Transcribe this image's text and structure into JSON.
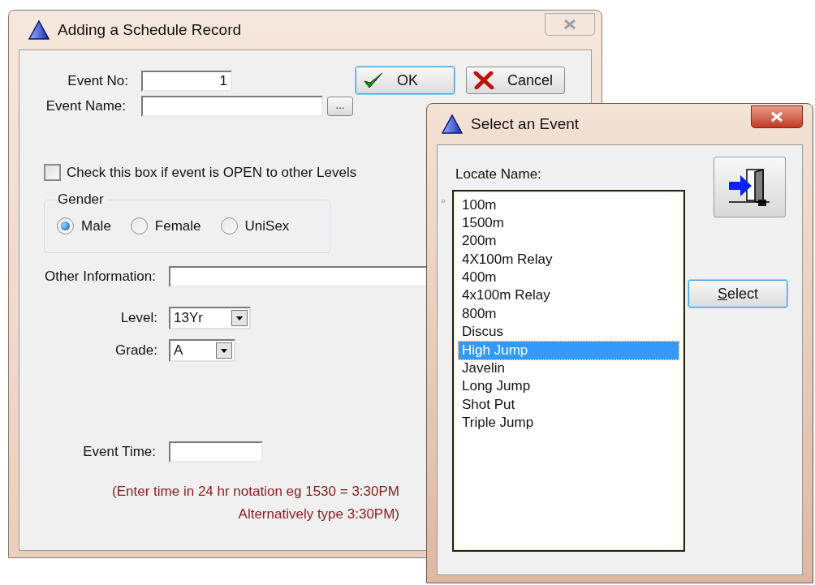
{
  "main_window": {
    "title": "Adding a Schedule Record",
    "event_no": {
      "label": "Event No:",
      "value": "1"
    },
    "event_name": {
      "label": "Event Name:",
      "browse_button": "..."
    },
    "buttons": [
      {
        "kind": "ok",
        "label": "OK",
        "focused": true
      },
      {
        "kind": "cancel",
        "label": "Cancel",
        "focused": false
      }
    ],
    "open_checkbox": {
      "label": "Check this box if event is OPEN to other Levels",
      "checked": false
    },
    "gender": {
      "legend": "Gender",
      "options": [
        {
          "label": "Male",
          "selected": true
        },
        {
          "label": "Female",
          "selected": false
        },
        {
          "label": "UniSex",
          "selected": false
        }
      ]
    },
    "other_information": {
      "label": "Other Information:"
    },
    "level": {
      "label": "Level:",
      "value": "13Yr"
    },
    "grade": {
      "label": "Grade:",
      "value": "A"
    },
    "event_time": {
      "label": "Event Time:"
    },
    "hint_lines": [
      "(Enter time in 24 hr notation eg 1530 = 3:30PM",
      "Alternatively type 3:30PM)"
    ]
  },
  "select_window": {
    "title": "Select an Event",
    "locate_label": "Locate Name:",
    "row_pointer": "»",
    "events": [
      {
        "name": "100m",
        "selected": false
      },
      {
        "name": "1500m",
        "selected": false
      },
      {
        "name": "200m",
        "selected": false
      },
      {
        "name": "4X100m Relay",
        "selected": false
      },
      {
        "name": "400m",
        "selected": false
      },
      {
        "name": "4x100m Relay",
        "selected": false
      },
      {
        "name": "800m",
        "selected": false
      },
      {
        "name": "Discus",
        "selected": false
      },
      {
        "name": "High Jump",
        "selected": true
      },
      {
        "name": "Javelin",
        "selected": false
      },
      {
        "name": "Long Jump",
        "selected": false
      },
      {
        "name": "Shot Put",
        "selected": false
      },
      {
        "name": "Triple Jump",
        "selected": false
      }
    ],
    "select_button": {
      "label": "Select",
      "mnemonic_underlined": true
    }
  }
}
